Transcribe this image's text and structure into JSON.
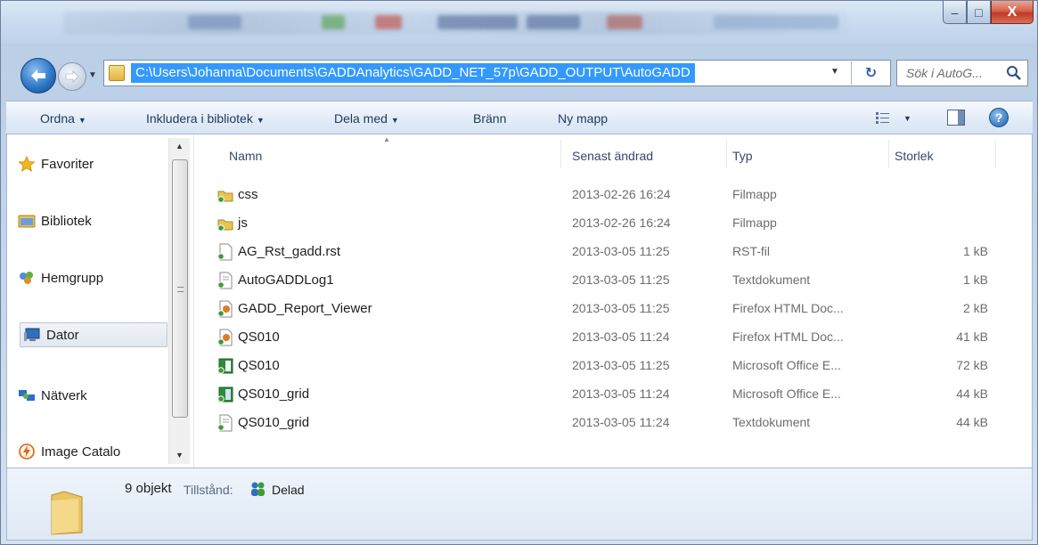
{
  "window": {
    "caption_buttons": [
      "–",
      "□",
      "X"
    ]
  },
  "nav": {
    "back_icon": "back-arrow-icon",
    "forward_icon": "forward-arrow-icon",
    "address_path": "C:\\Users\\Johanna\\Documents\\GADDAnalytics\\GADD_NET_57p\\GADD_OUTPUT\\AutoGADD",
    "search_placeholder": "Sök i AutoG...",
    "refresh_glyph": "↻"
  },
  "toolbar": {
    "organize": "Ordna",
    "include_in_library": "Inkludera i bibliotek",
    "share_with": "Dela med",
    "burn": "Bränn",
    "new_folder": "Ny mapp",
    "help_glyph": "?"
  },
  "sidebar": {
    "items": [
      {
        "label": "Favoriter",
        "icon": "star-icon"
      },
      {
        "label": "Bibliotek",
        "icon": "library-icon"
      },
      {
        "label": "Hemgrupp",
        "icon": "homegroup-icon"
      },
      {
        "label": "Dator",
        "icon": "computer-icon"
      },
      {
        "label": "Nätverk",
        "icon": "network-icon"
      },
      {
        "label": "Image Catalo",
        "icon": "image-catalog-icon"
      }
    ]
  },
  "files": {
    "columns": [
      "Namn",
      "Senast ändrad",
      "Typ",
      "Storlek"
    ],
    "rows": [
      {
        "name": "css",
        "modified": "2013-02-26 16:24",
        "type": "Filmapp",
        "size": "",
        "icon": "folder-icon"
      },
      {
        "name": "js",
        "modified": "2013-02-26 16:24",
        "type": "Filmapp",
        "size": "",
        "icon": "folder-icon"
      },
      {
        "name": "AG_Rst_gadd.rst",
        "modified": "2013-03-05 11:25",
        "type": "RST-fil",
        "size": "1 kB",
        "icon": "file-icon"
      },
      {
        "name": "AutoGADDLog1",
        "modified": "2013-03-05 11:25",
        "type": "Textdokument",
        "size": "1 kB",
        "icon": "text-file-icon"
      },
      {
        "name": "GADD_Report_Viewer",
        "modified": "2013-03-05 11:25",
        "type": "Firefox HTML Doc...",
        "size": "2 kB",
        "icon": "html-file-icon"
      },
      {
        "name": "QS010",
        "modified": "2013-03-05 11:24",
        "type": "Firefox HTML Doc...",
        "size": "41 kB",
        "icon": "html-file-icon"
      },
      {
        "name": "QS010",
        "modified": "2013-03-05 11:25",
        "type": "Microsoft Office E...",
        "size": "72 kB",
        "icon": "excel-file-icon"
      },
      {
        "name": "QS010_grid",
        "modified": "2013-03-05 11:24",
        "type": "Microsoft Office E...",
        "size": "44 kB",
        "icon": "excel-file-icon"
      },
      {
        "name": "QS010_grid",
        "modified": "2013-03-05 11:24",
        "type": "Textdokument",
        "size": "44 kB",
        "icon": "text-file-icon"
      }
    ]
  },
  "details": {
    "count": "9 objekt",
    "status_label": "Tillstånd:",
    "status_value": "Delad"
  },
  "colors": {
    "address_highlight": "#3399ff",
    "close_button": "#c13a22",
    "chrome": "#c6d8ee"
  }
}
